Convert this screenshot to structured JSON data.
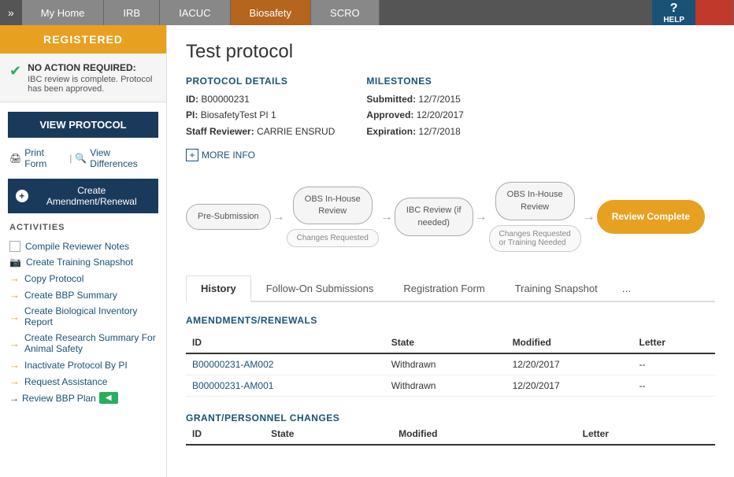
{
  "nav": {
    "expand_label": "»",
    "items": [
      {
        "id": "my-home",
        "label": "My Home",
        "active": false
      },
      {
        "id": "irb",
        "label": "IRB",
        "active": false
      },
      {
        "id": "iacuc",
        "label": "IACUC",
        "active": false
      },
      {
        "id": "biosafety",
        "label": "Biosafety",
        "active": true
      },
      {
        "id": "scro",
        "label": "SCRO",
        "active": false
      }
    ],
    "help_label": "HELP"
  },
  "sidebar": {
    "registered_label": "REGISTERED",
    "no_action_title": "NO ACTION REQUIRED:",
    "no_action_text": "IBC review is complete. Protocol has been approved.",
    "view_protocol_label": "VIEW PROTOCOL",
    "print_label": "Print Form",
    "view_diff_label": "View Differences",
    "create_amendment_label": "Create Amendment/Renewal",
    "activities_title": "ACTIVITIES",
    "activities": [
      {
        "type": "checkbox",
        "label": "Compile Reviewer Notes"
      },
      {
        "type": "camera",
        "label": "Create Training Snapshot"
      },
      {
        "type": "arrow",
        "label": "Copy Protocol"
      },
      {
        "type": "arrow",
        "label": "Create BBP Summary"
      },
      {
        "type": "arrow",
        "label": "Create Biological Inventory Report"
      },
      {
        "type": "arrow",
        "label": "Create Research Summary For Animal Safety"
      },
      {
        "type": "arrow",
        "label": "Inactivate Protocol By PI"
      },
      {
        "type": "arrow",
        "label": "Request Assistance"
      },
      {
        "type": "arrow-special",
        "label": "Review BBP Plan"
      }
    ]
  },
  "main": {
    "title": "Test protocol",
    "protocol_details": {
      "heading": "PROTOCOL DETAILS",
      "id_label": "ID:",
      "id_value": "B00000231",
      "pi_label": "PI:",
      "pi_value": "BiosafetyTest PI 1",
      "staff_label": "Staff Reviewer:",
      "staff_value": "CARRIE ENSRUD"
    },
    "milestones": {
      "heading": "MILESTONES",
      "submitted_label": "Submitted:",
      "submitted_value": "12/7/2015",
      "approved_label": "Approved:",
      "approved_value": "12/20/2017",
      "expiration_label": "Expiration:",
      "expiration_value": "12/7/2018"
    },
    "more_info_label": "MORE INFO",
    "workflow": {
      "nodes": [
        {
          "id": "pre-submission",
          "label": "Pre-Submission",
          "sub": null,
          "active": false
        },
        {
          "id": "obs-inhouse-1",
          "label": "OBS In-House Review",
          "sub": "Changes Requested",
          "active": false
        },
        {
          "id": "ibc-review",
          "label": "IBC Review (if needed)",
          "sub": null,
          "active": false
        },
        {
          "id": "obs-inhouse-2",
          "label": "OBS In-House Review",
          "sub": "Changes Requested or Training Needed",
          "active": false
        },
        {
          "id": "review-complete",
          "label": "Review Complete",
          "sub": null,
          "active": true
        }
      ]
    },
    "tabs": [
      {
        "id": "history",
        "label": "History",
        "active": true
      },
      {
        "id": "follow-on",
        "label": "Follow-On Submissions",
        "active": false
      },
      {
        "id": "registration-form",
        "label": "Registration Form",
        "active": false
      },
      {
        "id": "training-snapshot",
        "label": "Training Snapshot",
        "active": false
      },
      {
        "id": "more",
        "label": "...",
        "active": false
      }
    ],
    "amendments_section": {
      "title": "AMENDMENTS/RENEWALS",
      "columns": [
        "ID",
        "State",
        "Modified",
        "Letter"
      ],
      "rows": [
        {
          "id": "B00000231-AM002",
          "state": "Withdrawn",
          "modified": "12/20/2017",
          "letter": "--"
        },
        {
          "id": "B00000231-AM001",
          "state": "Withdrawn",
          "modified": "12/20/2017",
          "letter": "--"
        }
      ]
    },
    "grant_section": {
      "title": "GRANT/PERSONNEL CHANGES",
      "columns": [
        "ID",
        "State",
        "Modified",
        "Letter"
      ]
    }
  }
}
